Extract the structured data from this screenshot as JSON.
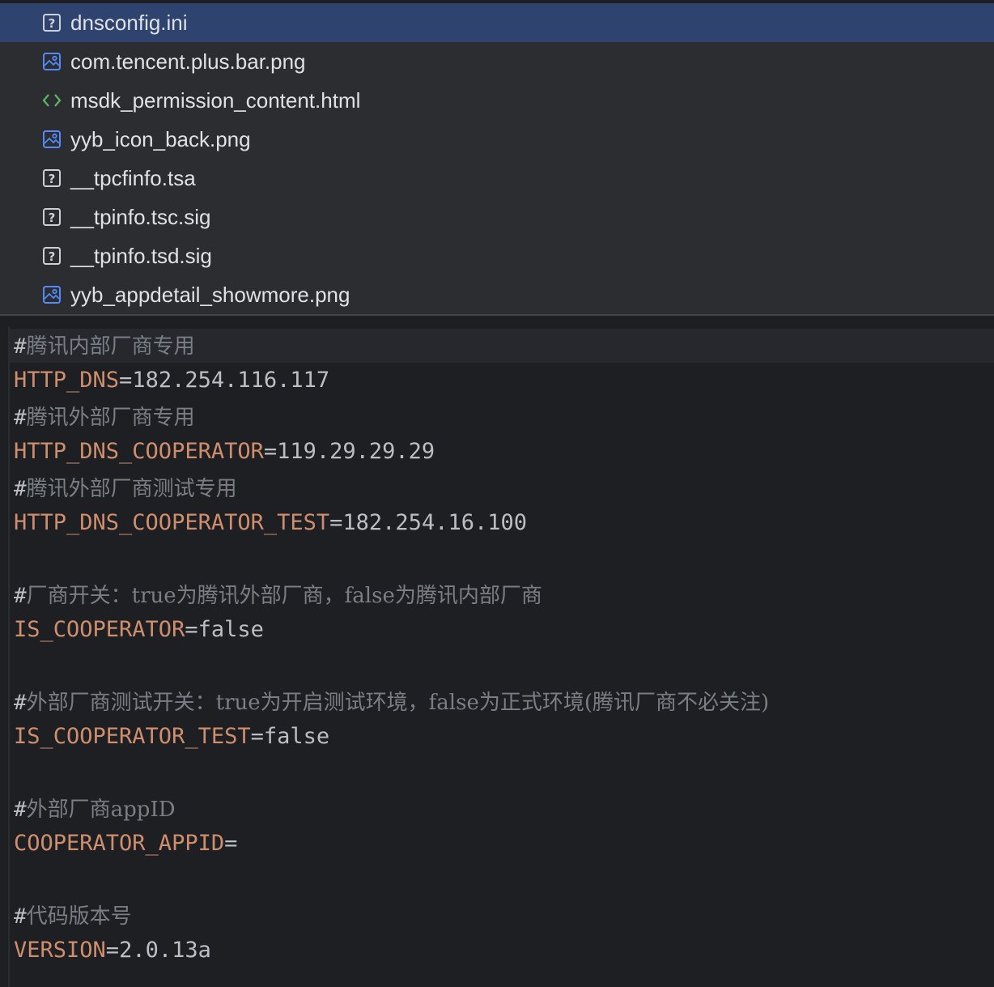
{
  "file_tree": {
    "files": [
      {
        "name": "dnsconfig.ini",
        "icon": "unknown-file-icon",
        "selected": true
      },
      {
        "name": "com.tencent.plus.bar.png",
        "icon": "image-file-icon",
        "selected": false
      },
      {
        "name": "msdk_permission_content.html",
        "icon": "html-file-icon",
        "selected": false
      },
      {
        "name": "yyb_icon_back.png",
        "icon": "image-file-icon",
        "selected": false
      },
      {
        "name": "__tpcfinfo.tsa",
        "icon": "unknown-file-icon",
        "selected": false
      },
      {
        "name": "__tpinfo.tsc.sig",
        "icon": "unknown-file-icon",
        "selected": false
      },
      {
        "name": "__tpinfo.tsd.sig",
        "icon": "unknown-file-icon",
        "selected": false
      },
      {
        "name": "yyb_appdetail_showmore.png",
        "icon": "image-file-icon",
        "selected": false
      }
    ]
  },
  "editor": {
    "lines": [
      {
        "type": "comment",
        "hash": "#",
        "text": "腾讯内部厂商专用"
      },
      {
        "type": "kv",
        "key": "HTTP_DNS",
        "eq": "=",
        "value": "182.254.116.117"
      },
      {
        "type": "comment",
        "hash": "#",
        "text": "腾讯外部厂商专用"
      },
      {
        "type": "kv",
        "key": "HTTP_DNS_COOPERATOR",
        "eq": "=",
        "value": "119.29.29.29"
      },
      {
        "type": "comment",
        "hash": "#",
        "text": "腾讯外部厂商测试专用"
      },
      {
        "type": "kv",
        "key": "HTTP_DNS_COOPERATOR_TEST",
        "eq": "=",
        "value": "182.254.16.100"
      },
      {
        "type": "comment",
        "hash": "#",
        "text": "厂商开关：true为腾讯外部厂商，false为腾讯内部厂商"
      },
      {
        "type": "kv",
        "key": "IS_COOPERATOR",
        "eq": "=",
        "value": "false"
      },
      {
        "type": "comment",
        "hash": "#",
        "text": "外部厂商测试开关：true为开启测试环境，false为正式环境(腾讯厂商不必关注)"
      },
      {
        "type": "kv",
        "key": "IS_COOPERATOR_TEST",
        "eq": "=",
        "value": "false"
      },
      {
        "type": "comment",
        "hash": "#",
        "text": "外部厂商appID"
      },
      {
        "type": "kv",
        "key": "COOPERATOR_APPID",
        "eq": "=",
        "value": ""
      },
      {
        "type": "comment",
        "hash": "#",
        "text": "代码版本号"
      },
      {
        "type": "kv",
        "key": "VERSION",
        "eq": "=",
        "value": "2.0.13a"
      }
    ]
  },
  "colors": {
    "selection": "#2e436e",
    "key": "#cf8e6d",
    "comment": "#7a7e85",
    "text": "#bcbec4",
    "html_icon": "#5fb865",
    "image_icon": "#548af7"
  }
}
